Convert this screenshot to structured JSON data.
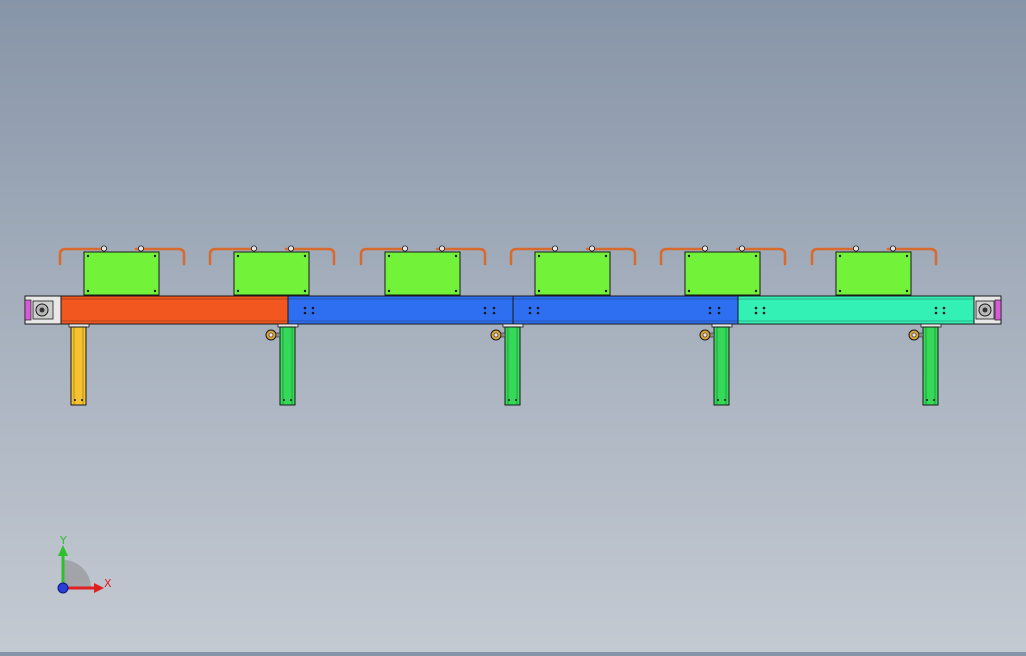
{
  "colors": {
    "background_top": "#8795a8",
    "background_bottom": "#c4cad2",
    "outline": "#1a1a1a",
    "segment_orange": "#f2571f",
    "segment_blue_1": "#2e6ff2",
    "segment_blue_2": "#2e6ff2",
    "segment_teal": "#33f0b5",
    "modules": "#73f23a",
    "handles": "#d96a2e",
    "leg_first": "#f7c12f",
    "legs": "#33d957",
    "end_caps": "#d65bd6",
    "x_axis": "#e02020",
    "y_axis": "#2fbf2f",
    "z_axis": "#2a3fd6"
  },
  "triad": {
    "x_label": "X",
    "y_label": "Y"
  }
}
